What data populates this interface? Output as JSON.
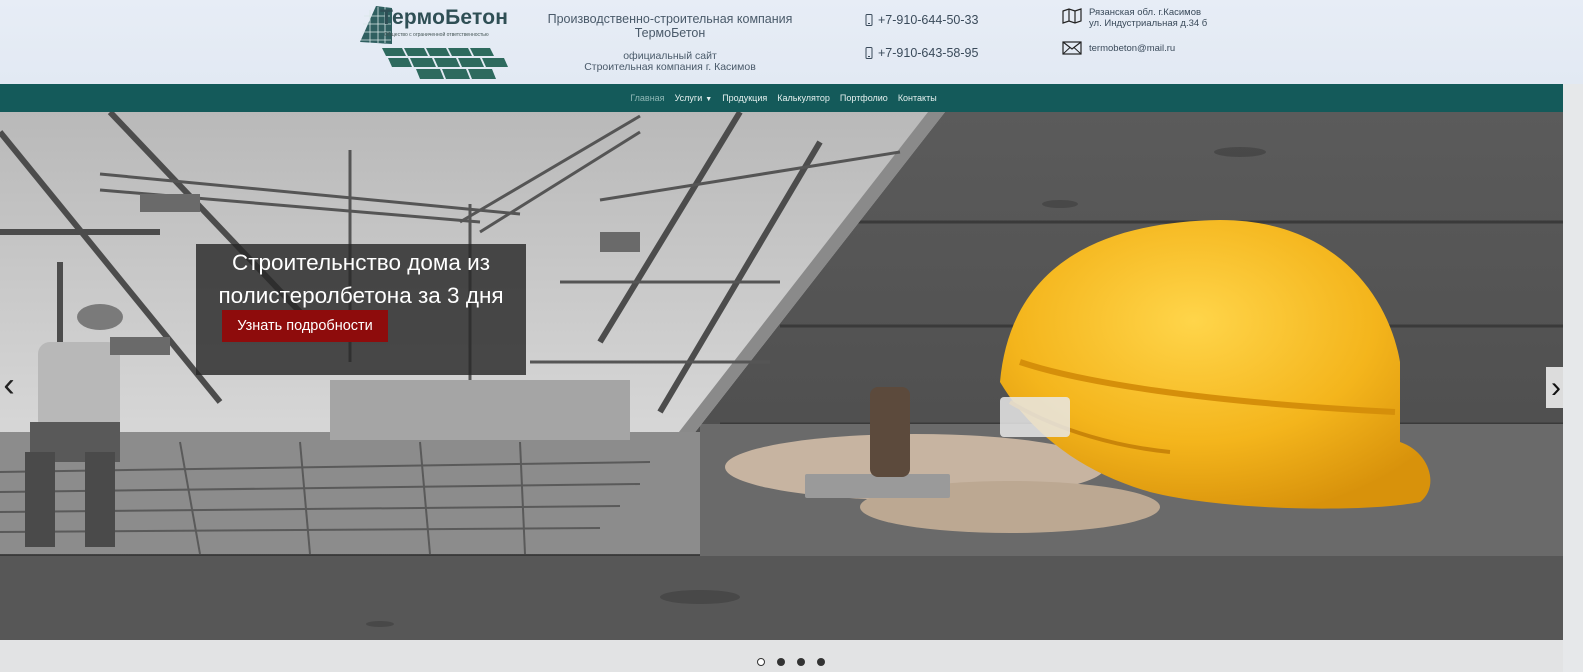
{
  "header": {
    "logo_text": "ТермоБетон",
    "logo_subtext": "Общество с ограниченной ответственностью",
    "company_title_line1": "Производственно-строительная компания",
    "company_title_line2": "ТермоБетон",
    "site_line1": "официальный сайт",
    "site_line2": "Строительная компания г. Касимов",
    "phones": [
      "+7-910-644-50-33",
      "+7-910-643-58-95"
    ],
    "address_line1": "Рязанская обл. г.Касимов",
    "address_line2": "ул. Индустриальная д.34 б",
    "email": "termobeton@mail.ru"
  },
  "nav": {
    "items": [
      {
        "label": "Главная",
        "active": true
      },
      {
        "label": "Услуги",
        "dropdown": true
      },
      {
        "label": "Продукция"
      },
      {
        "label": "Калькулятор"
      },
      {
        "label": "Портфолио"
      },
      {
        "label": "Контакты"
      }
    ]
  },
  "hero": {
    "caption_line1": "Строительнство дома из",
    "caption_line2": "полистеролбетона за 3 дня",
    "button_label": "Узнать подробности",
    "prev_arrow": "‹",
    "next_arrow": "›"
  },
  "carousel": {
    "slides": 4,
    "active_index": 0
  },
  "colors": {
    "nav_bg": "#145a5a",
    "button_bg": "#8e0c0c",
    "helmet": "#f2b619"
  }
}
